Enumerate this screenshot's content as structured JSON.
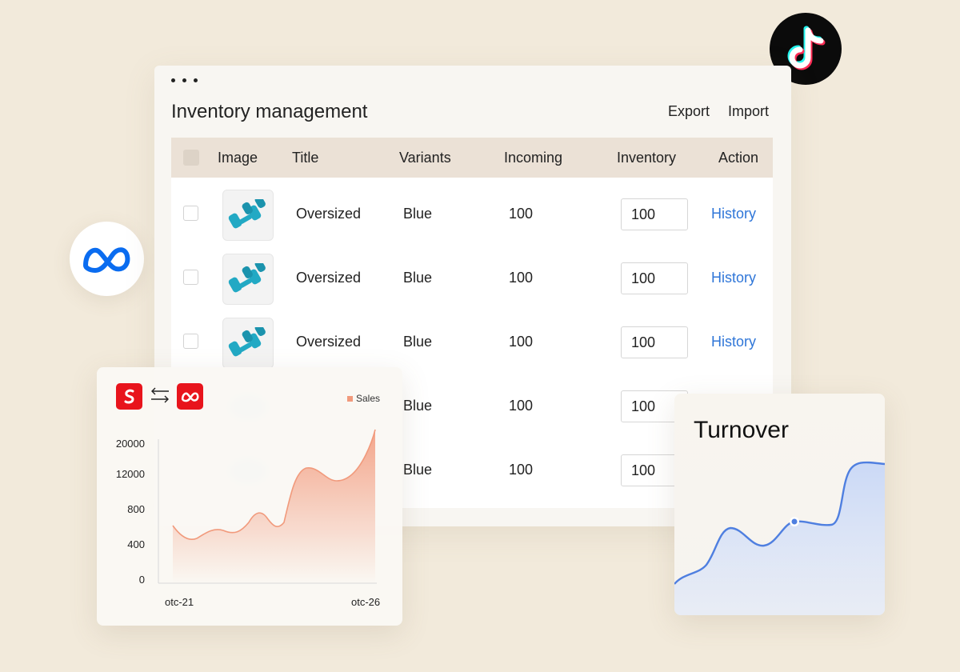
{
  "window": {
    "title": "Inventory management",
    "export_label": "Export",
    "import_label": "Import"
  },
  "table": {
    "columns": [
      "Image",
      "Title",
      "Variants",
      "Incoming",
      "Inventory",
      "Action"
    ],
    "rows": [
      {
        "title": "Oversized",
        "variant": "Blue",
        "incoming": "100",
        "inventory": "100",
        "action": "History"
      },
      {
        "title": "Oversized",
        "variant": "Blue",
        "incoming": "100",
        "inventory": "100",
        "action": "History"
      },
      {
        "title": "Oversized",
        "variant": "Blue",
        "incoming": "100",
        "inventory": "100",
        "action": "History"
      },
      {
        "variant": "Blue",
        "incoming": "100",
        "inventory": "100"
      },
      {
        "variant": "Blue",
        "incoming": "100",
        "inventory": "100"
      }
    ]
  },
  "sales_card": {
    "legend": "Sales",
    "y_ticks": [
      "20000",
      "12000",
      "800",
      "400",
      "0"
    ],
    "x_ticks": [
      "otc-21",
      "otc-26"
    ]
  },
  "turnover_card": {
    "title": "Turnover"
  },
  "colors": {
    "accent_link": "#2f76d8",
    "sales_line": "#f19a7c",
    "turnover_line": "#4f7fe0",
    "brand_red": "#e8141c",
    "meta_blue": "#0a6cf0"
  },
  "icons": [
    "tiktok-logo-icon",
    "meta-logo-icon",
    "shopify-logo-icon",
    "swap-arrows-icon",
    "dumbbell-icon"
  ]
}
